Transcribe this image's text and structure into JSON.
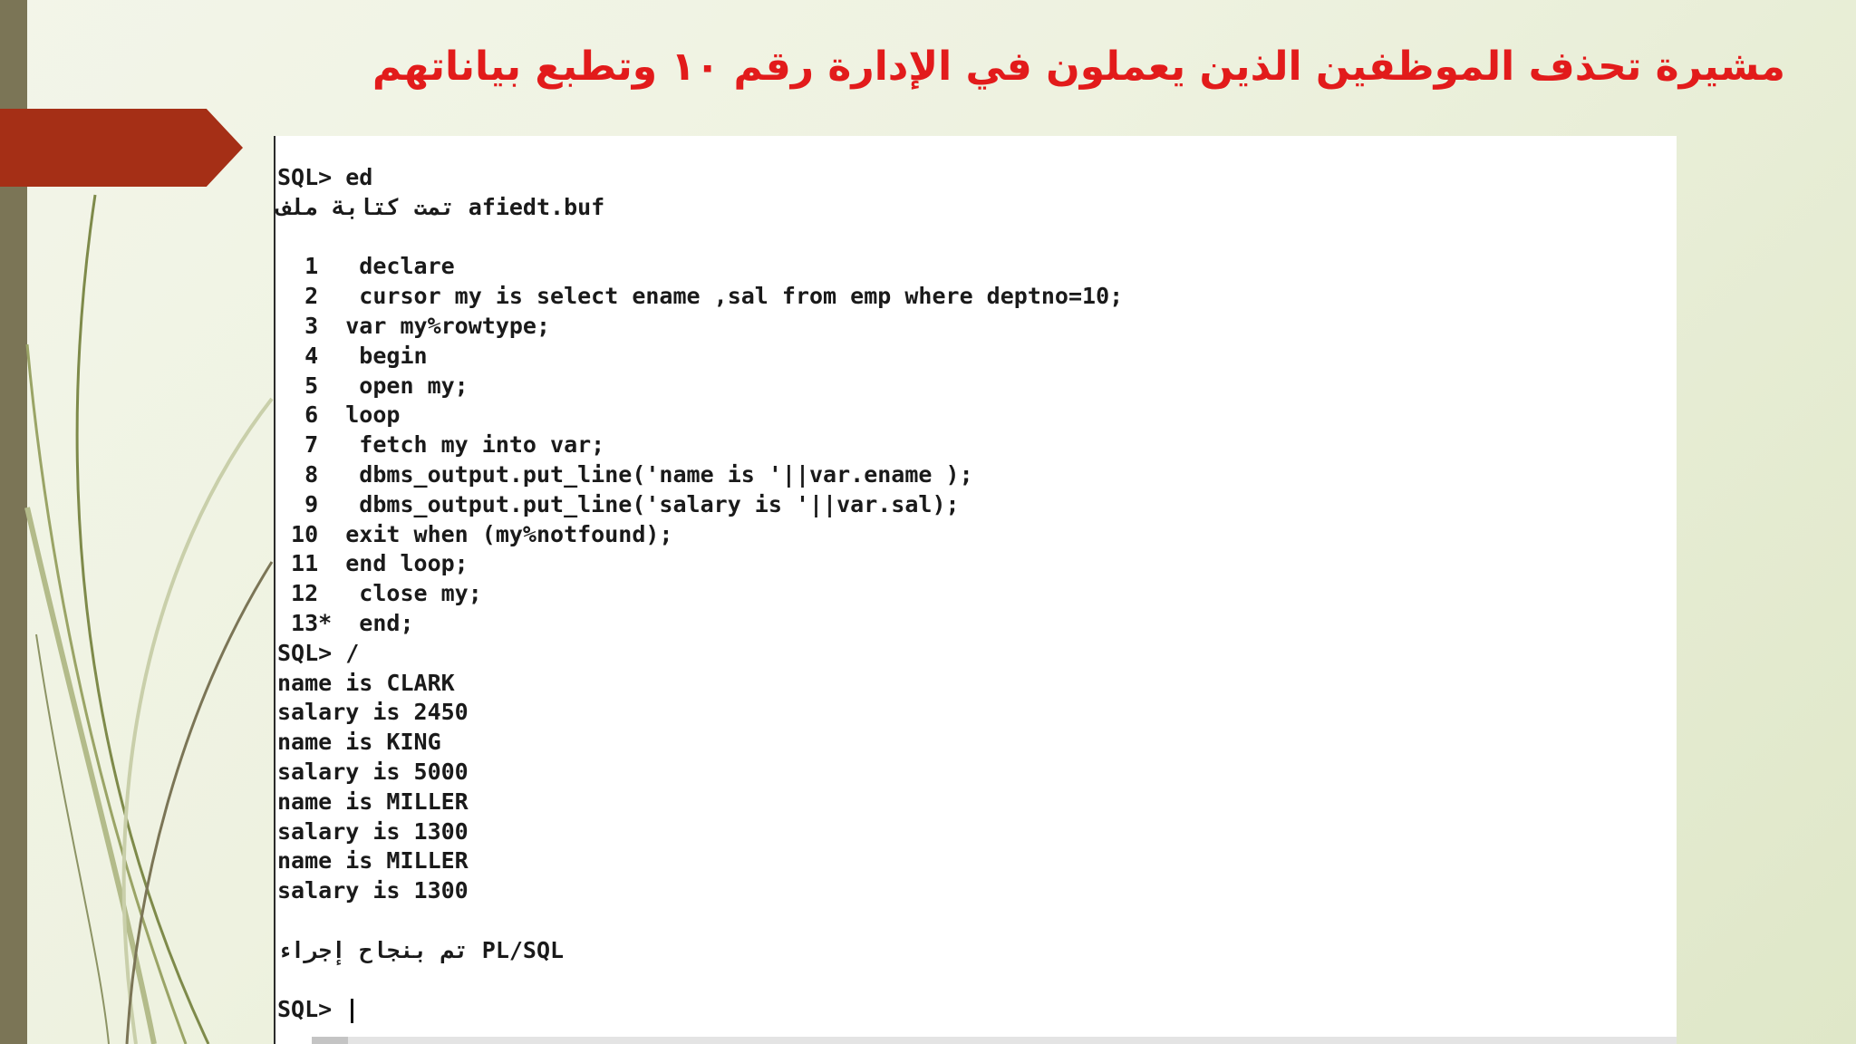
{
  "slide": {
    "title": "مشيرة تحذف الموظفين الذين يعملون في الإدارة رقم ١٠ وتطبع بياناتهم"
  },
  "colors": {
    "title": "#e21b1b",
    "accent_arrow": "#a52f16",
    "left_bar": "#7b7556",
    "background": "#eef2e0",
    "terminal_bg": "#ffffff"
  },
  "terminal": {
    "lines": [
      "SQL> ed",
      "تمت كتابة ملف afiedt.buf",
      "",
      "  1   declare",
      "  2   cursor my is select ename ,sal from emp where deptno=10;",
      "  3  var my%rowtype;",
      "  4   begin",
      "  5   open my;",
      "  6  loop",
      "  7   fetch my into var;",
      "  8   dbms_output.put_line('name is '||var.ename );",
      "  9   dbms_output.put_line('salary is '||var.sal);",
      " 10  exit when (my%notfound);",
      " 11  end loop;",
      " 12   close my;",
      " 13*  end;",
      "SQL> /",
      "name is CLARK",
      "salary is 2450",
      "name is KING",
      "salary is 5000",
      "name is MILLER",
      "salary is 1300",
      "name is MILLER",
      "salary is 1300",
      "",
      "تم بنجاح إجراء PL/SQL",
      "",
      "SQL> "
    ]
  }
}
